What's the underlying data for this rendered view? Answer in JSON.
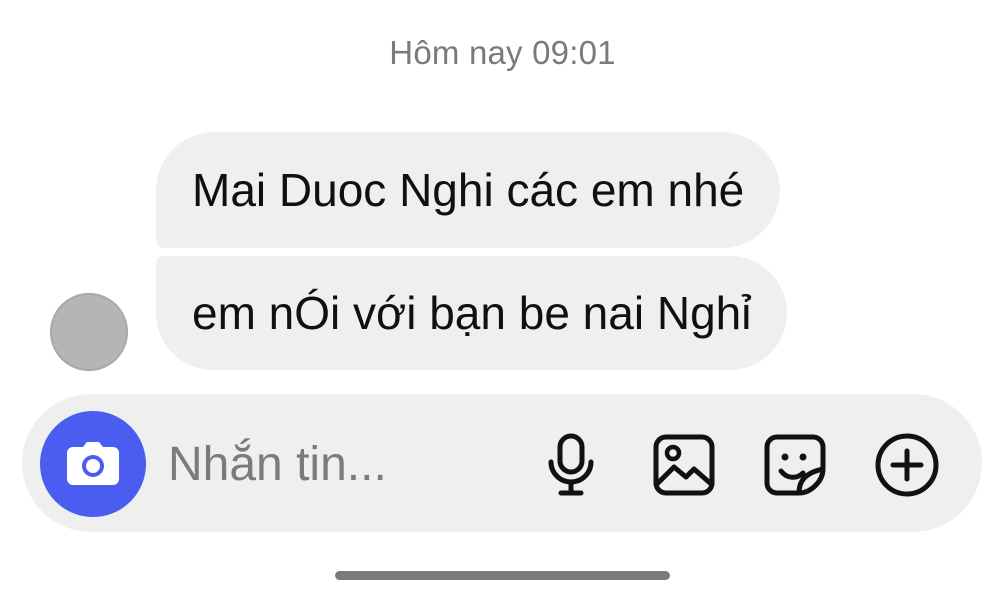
{
  "chat": {
    "timestamp": "Hôm nay 09:01",
    "messages": [
      {
        "text": "Mai Duoc Nghi các em nhé"
      },
      {
        "text": "em nÓi với bạn be nai Nghỉ"
      }
    ]
  },
  "composer": {
    "placeholder": "Nhắn tin...",
    "icons": {
      "camera": "camera-icon",
      "mic": "microphone-icon",
      "image": "image-icon",
      "sticker": "sticker-icon",
      "more": "plus-circle-icon"
    }
  },
  "colors": {
    "accent": "#4a5df0",
    "bubble": "#efefef",
    "timestamp": "#7a7a7a"
  }
}
